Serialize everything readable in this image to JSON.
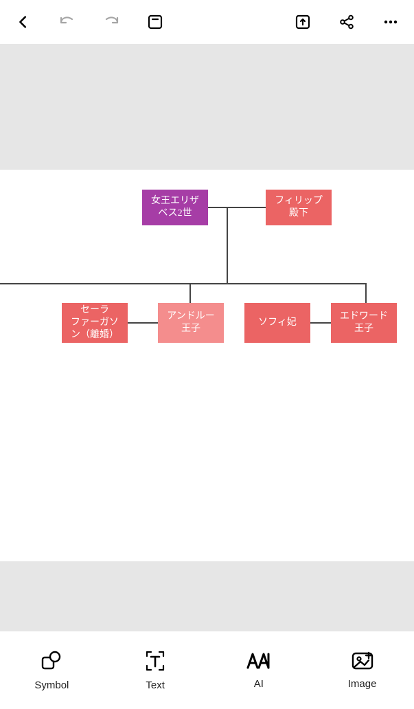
{
  "nodes": {
    "queen": "女王エリザ\nベス2世",
    "philip": "フィリップ\n殿下",
    "sarah": "セーラ\nファーガソ\nン（離婚）",
    "andrew": "アンドルー\n王子",
    "sophie": "ソフィ妃",
    "edward": "エドワード\n王子"
  },
  "bottom": {
    "symbol": "Symbol",
    "text": "Text",
    "ai": "AI",
    "image": "Image"
  }
}
